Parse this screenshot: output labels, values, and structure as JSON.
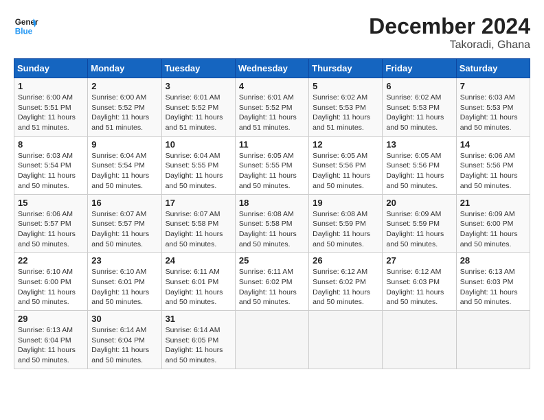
{
  "header": {
    "logo": {
      "line1": "General",
      "line2": "Blue"
    },
    "title": "December 2024",
    "subtitle": "Takoradi, Ghana"
  },
  "weekdays": [
    "Sunday",
    "Monday",
    "Tuesday",
    "Wednesday",
    "Thursday",
    "Friday",
    "Saturday"
  ],
  "weeks": [
    [
      {
        "day": 1,
        "sunrise": "6:00 AM",
        "sunset": "5:51 PM",
        "daylight": "11 hours and 51 minutes."
      },
      {
        "day": 2,
        "sunrise": "6:00 AM",
        "sunset": "5:52 PM",
        "daylight": "11 hours and 51 minutes."
      },
      {
        "day": 3,
        "sunrise": "6:01 AM",
        "sunset": "5:52 PM",
        "daylight": "11 hours and 51 minutes."
      },
      {
        "day": 4,
        "sunrise": "6:01 AM",
        "sunset": "5:52 PM",
        "daylight": "11 hours and 51 minutes."
      },
      {
        "day": 5,
        "sunrise": "6:02 AM",
        "sunset": "5:53 PM",
        "daylight": "11 hours and 51 minutes."
      },
      {
        "day": 6,
        "sunrise": "6:02 AM",
        "sunset": "5:53 PM",
        "daylight": "11 hours and 50 minutes."
      },
      {
        "day": 7,
        "sunrise": "6:03 AM",
        "sunset": "5:53 PM",
        "daylight": "11 hours and 50 minutes."
      }
    ],
    [
      {
        "day": 8,
        "sunrise": "6:03 AM",
        "sunset": "5:54 PM",
        "daylight": "11 hours and 50 minutes."
      },
      {
        "day": 9,
        "sunrise": "6:04 AM",
        "sunset": "5:54 PM",
        "daylight": "11 hours and 50 minutes."
      },
      {
        "day": 10,
        "sunrise": "6:04 AM",
        "sunset": "5:55 PM",
        "daylight": "11 hours and 50 minutes."
      },
      {
        "day": 11,
        "sunrise": "6:05 AM",
        "sunset": "5:55 PM",
        "daylight": "11 hours and 50 minutes."
      },
      {
        "day": 12,
        "sunrise": "6:05 AM",
        "sunset": "5:56 PM",
        "daylight": "11 hours and 50 minutes."
      },
      {
        "day": 13,
        "sunrise": "6:05 AM",
        "sunset": "5:56 PM",
        "daylight": "11 hours and 50 minutes."
      },
      {
        "day": 14,
        "sunrise": "6:06 AM",
        "sunset": "5:56 PM",
        "daylight": "11 hours and 50 minutes."
      }
    ],
    [
      {
        "day": 15,
        "sunrise": "6:06 AM",
        "sunset": "5:57 PM",
        "daylight": "11 hours and 50 minutes."
      },
      {
        "day": 16,
        "sunrise": "6:07 AM",
        "sunset": "5:57 PM",
        "daylight": "11 hours and 50 minutes."
      },
      {
        "day": 17,
        "sunrise": "6:07 AM",
        "sunset": "5:58 PM",
        "daylight": "11 hours and 50 minutes."
      },
      {
        "day": 18,
        "sunrise": "6:08 AM",
        "sunset": "5:58 PM",
        "daylight": "11 hours and 50 minutes."
      },
      {
        "day": 19,
        "sunrise": "6:08 AM",
        "sunset": "5:59 PM",
        "daylight": "11 hours and 50 minutes."
      },
      {
        "day": 20,
        "sunrise": "6:09 AM",
        "sunset": "5:59 PM",
        "daylight": "11 hours and 50 minutes."
      },
      {
        "day": 21,
        "sunrise": "6:09 AM",
        "sunset": "6:00 PM",
        "daylight": "11 hours and 50 minutes."
      }
    ],
    [
      {
        "day": 22,
        "sunrise": "6:10 AM",
        "sunset": "6:00 PM",
        "daylight": "11 hours and 50 minutes."
      },
      {
        "day": 23,
        "sunrise": "6:10 AM",
        "sunset": "6:01 PM",
        "daylight": "11 hours and 50 minutes."
      },
      {
        "day": 24,
        "sunrise": "6:11 AM",
        "sunset": "6:01 PM",
        "daylight": "11 hours and 50 minutes."
      },
      {
        "day": 25,
        "sunrise": "6:11 AM",
        "sunset": "6:02 PM",
        "daylight": "11 hours and 50 minutes."
      },
      {
        "day": 26,
        "sunrise": "6:12 AM",
        "sunset": "6:02 PM",
        "daylight": "11 hours and 50 minutes."
      },
      {
        "day": 27,
        "sunrise": "6:12 AM",
        "sunset": "6:03 PM",
        "daylight": "11 hours and 50 minutes."
      },
      {
        "day": 28,
        "sunrise": "6:13 AM",
        "sunset": "6:03 PM",
        "daylight": "11 hours and 50 minutes."
      }
    ],
    [
      {
        "day": 29,
        "sunrise": "6:13 AM",
        "sunset": "6:04 PM",
        "daylight": "11 hours and 50 minutes."
      },
      {
        "day": 30,
        "sunrise": "6:14 AM",
        "sunset": "6:04 PM",
        "daylight": "11 hours and 50 minutes."
      },
      {
        "day": 31,
        "sunrise": "6:14 AM",
        "sunset": "6:05 PM",
        "daylight": "11 hours and 50 minutes."
      },
      null,
      null,
      null,
      null
    ]
  ]
}
